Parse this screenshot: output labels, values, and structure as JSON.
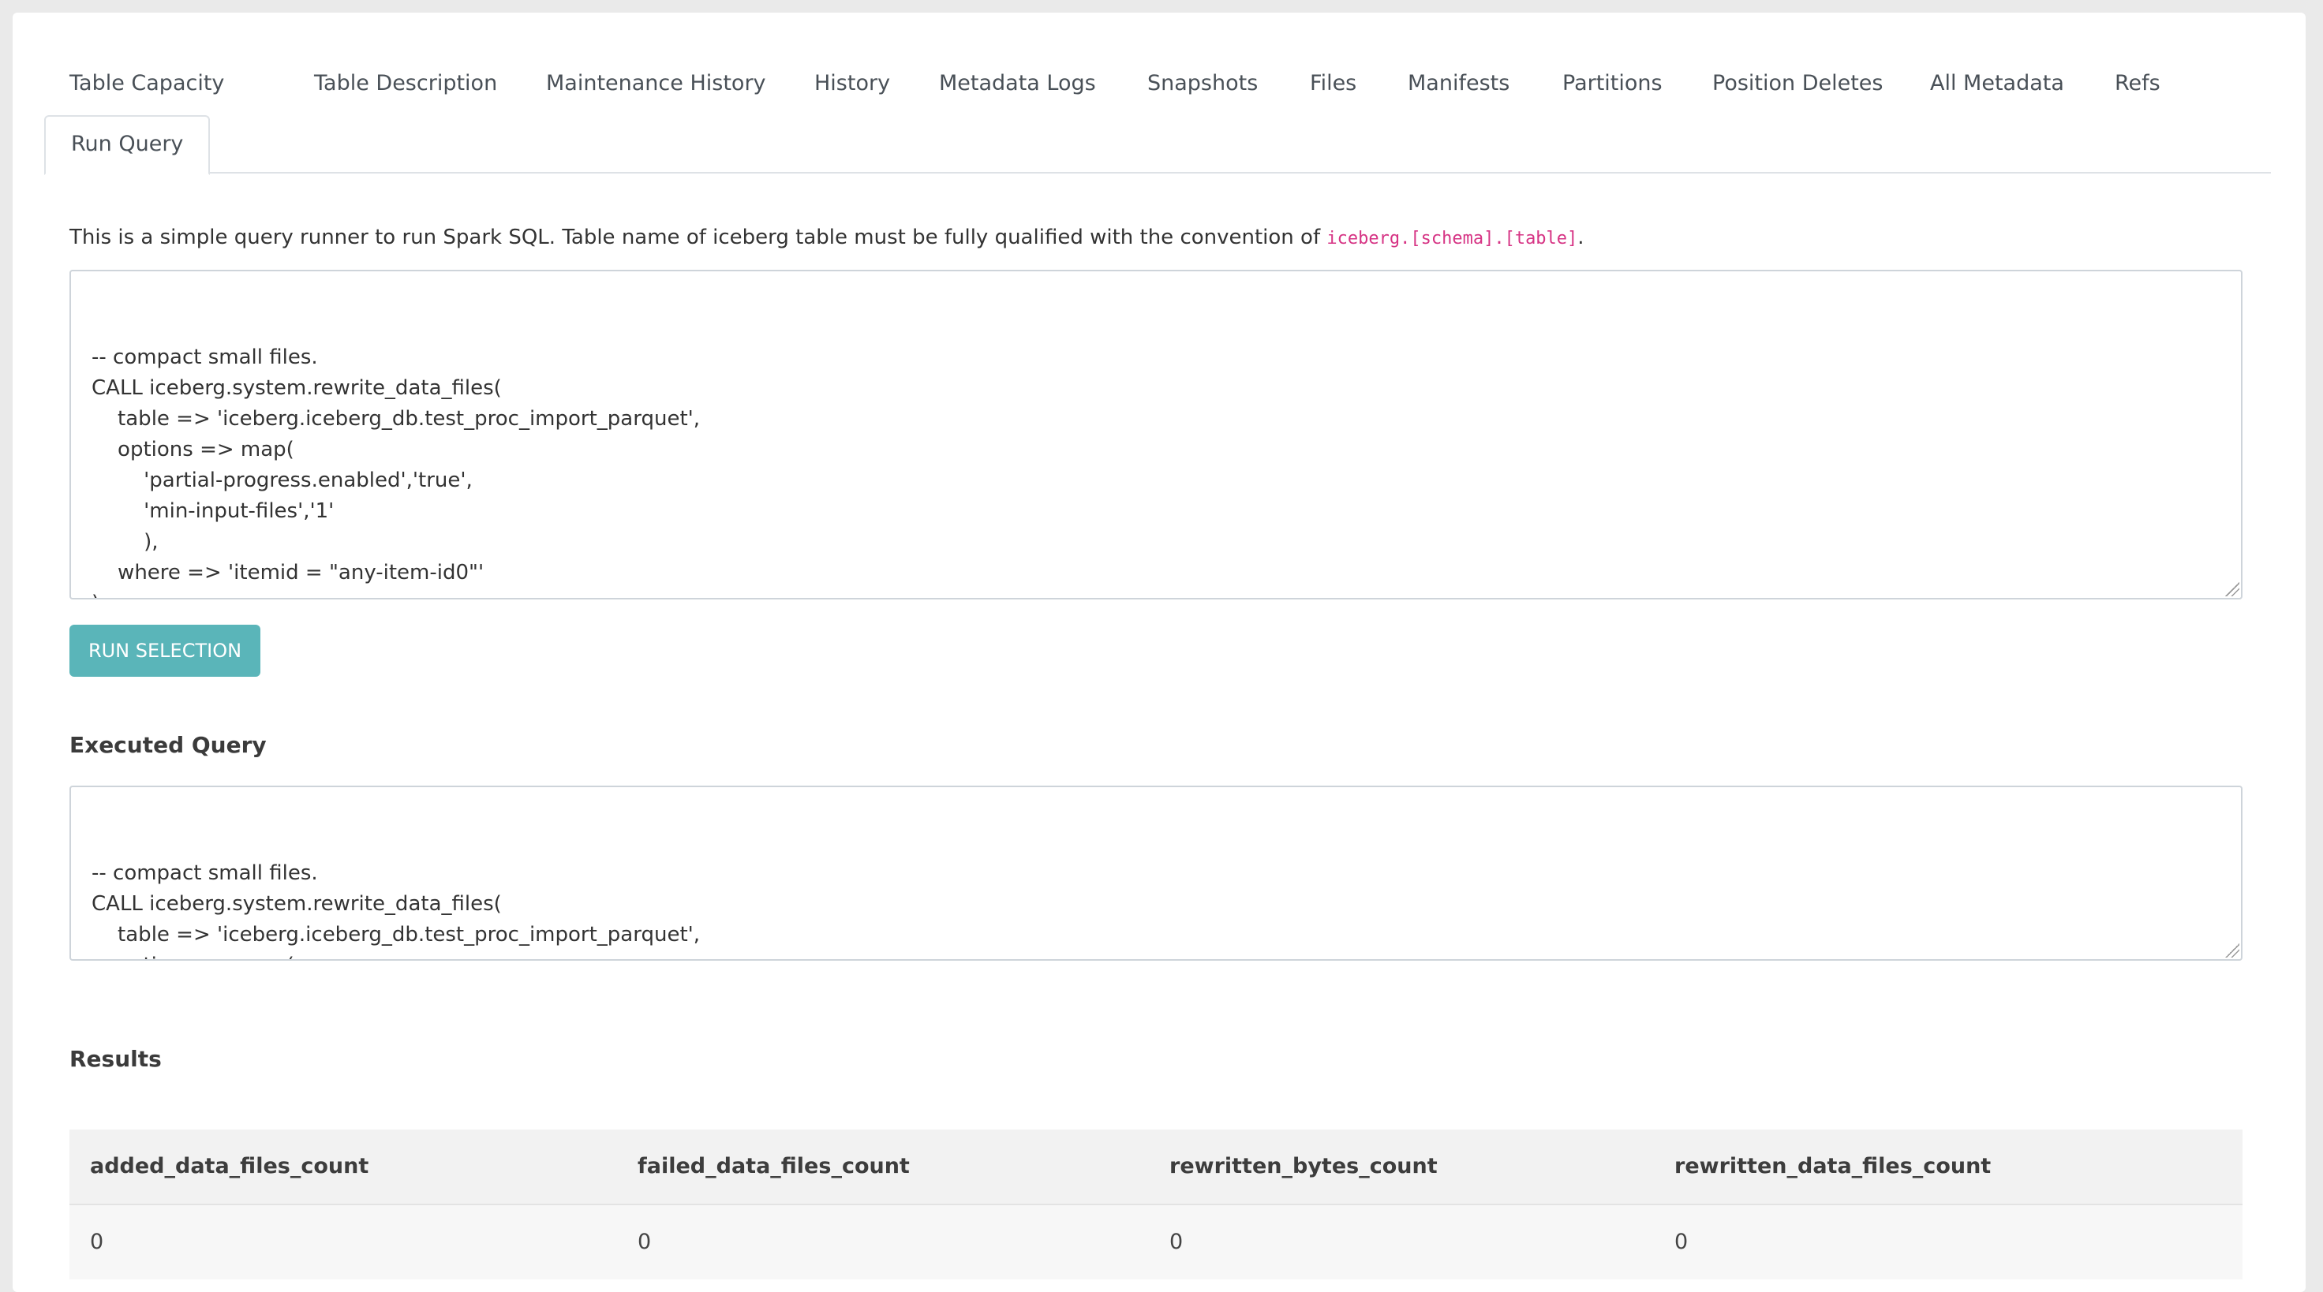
{
  "tabs": [
    "Table Capacity",
    "Table Description",
    "Maintenance History",
    "History",
    "Metadata Logs",
    "Snapshots",
    "Files",
    "Manifests",
    "Partitions",
    "Position Deletes",
    "All Metadata",
    "Refs",
    "Run Query"
  ],
  "active_tab": "Run Query",
  "description": {
    "text": "This is a simple query runner to run Spark SQL. Table name of iceberg table must be fully qualified with the convention of ",
    "code_prefix": "iceberg",
    "code_schema": ".[schema]",
    "code_table": ".[table]",
    "suffix": "."
  },
  "query_editor": {
    "value": "-- compact small files.\nCALL iceberg.system.rewrite_data_files(\n    table => 'iceberg.iceberg_db.test_proc_import_parquet',\n    options => map(\n        'partial-progress.enabled','true',\n        'min-input-files','1'\n        ),\n    where => 'itemid = \"any-item-id0\"'\n)"
  },
  "run_button": {
    "label": "RUN SELECTION"
  },
  "executed": {
    "heading": "Executed Query",
    "value": "-- compact small files.\nCALL iceberg.system.rewrite_data_files(\n    table => 'iceberg.iceberg_db.test_proc_import_parquet',\n    options => map(\n        'partial-progress.enabled','true',\n        'min-input-files','1'\n        ),\n    where => 'itemid = \"any-item-id0\"'\n)"
  },
  "results": {
    "heading": "Results",
    "columns": [
      "added_data_files_count",
      "failed_data_files_count",
      "rewritten_bytes_count",
      "rewritten_data_files_count"
    ],
    "rows": [
      [
        "0",
        "0",
        "0",
        "0"
      ]
    ]
  },
  "colors": {
    "accent": "#5ab5b9",
    "code": "#d63384"
  }
}
